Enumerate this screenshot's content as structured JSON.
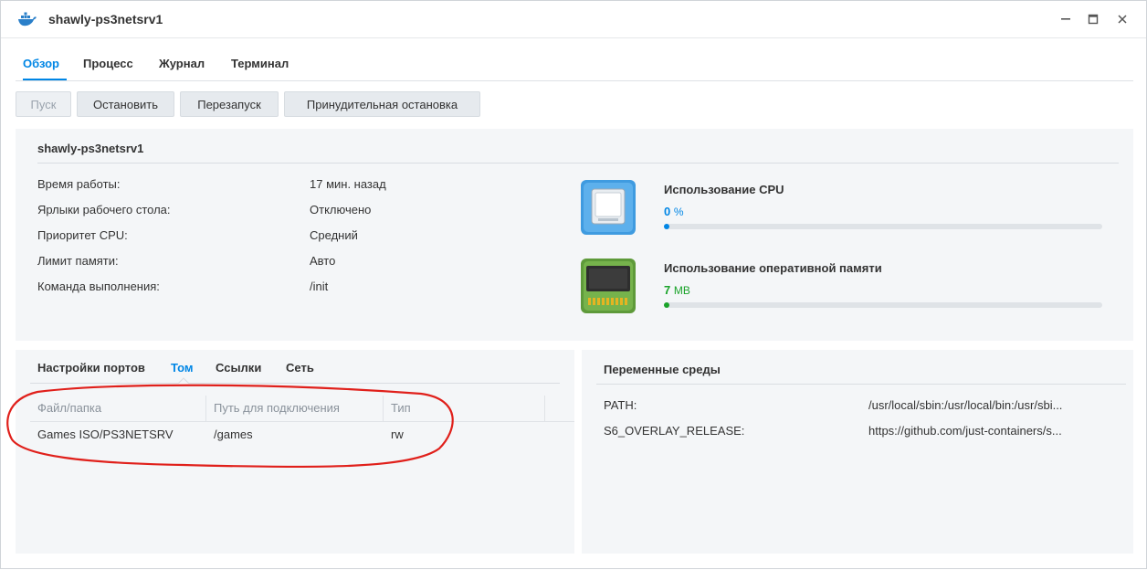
{
  "window": {
    "title": "shawly-ps3netsrv1"
  },
  "tabs": [
    {
      "label": "Обзор",
      "active": true
    },
    {
      "label": "Процесс"
    },
    {
      "label": "Журнал"
    },
    {
      "label": "Терминал"
    }
  ],
  "toolbar": {
    "start": "Пуск",
    "stop": "Остановить",
    "restart": "Перезапуск",
    "force_stop": "Принудительная остановка"
  },
  "overview": {
    "name": "shawly-ps3netsrv1",
    "rows": [
      {
        "label": "Время работы:",
        "value": "17 мин. назад"
      },
      {
        "label": "Ярлыки рабочего стола:",
        "value": "Отключено"
      },
      {
        "label": "Приоритет CPU:",
        "value": "Средний"
      },
      {
        "label": "Лимит памяти:",
        "value": "Авто"
      },
      {
        "label": "Команда выполнения:",
        "value": "/init"
      }
    ]
  },
  "resources": {
    "cpu": {
      "title": "Использование CPU",
      "value": "0",
      "unit": "%",
      "usage": 0.01,
      "color": "#0086e5",
      "icon": "cpu-icon"
    },
    "ram": {
      "title": "Использование оперативной памяти",
      "value": "7",
      "unit": "MB",
      "usage": 0.01,
      "color": "#1aa32a",
      "icon": "memory-icon"
    }
  },
  "storage": {
    "subtabs": [
      "Настройки портов",
      "Том",
      "Ссылки",
      "Сеть"
    ],
    "columns": [
      "Файл/папка",
      "Путь для подключения",
      "Тип"
    ],
    "rows": [
      {
        "file": "Games ISO/PS3NETSRV",
        "mount": "/games",
        "type": "rw"
      }
    ]
  },
  "env": {
    "title": "Переменные среды",
    "rows": [
      {
        "key": "PATH:",
        "value": "/usr/local/sbin:/usr/local/bin:/usr/sbi..."
      },
      {
        "key": "S6_OVERLAY_RELEASE:",
        "value": "https://github.com/just-containers/s..."
      }
    ]
  },
  "colors": {
    "accent": "#0086e5",
    "annotation": "#e0201b"
  }
}
